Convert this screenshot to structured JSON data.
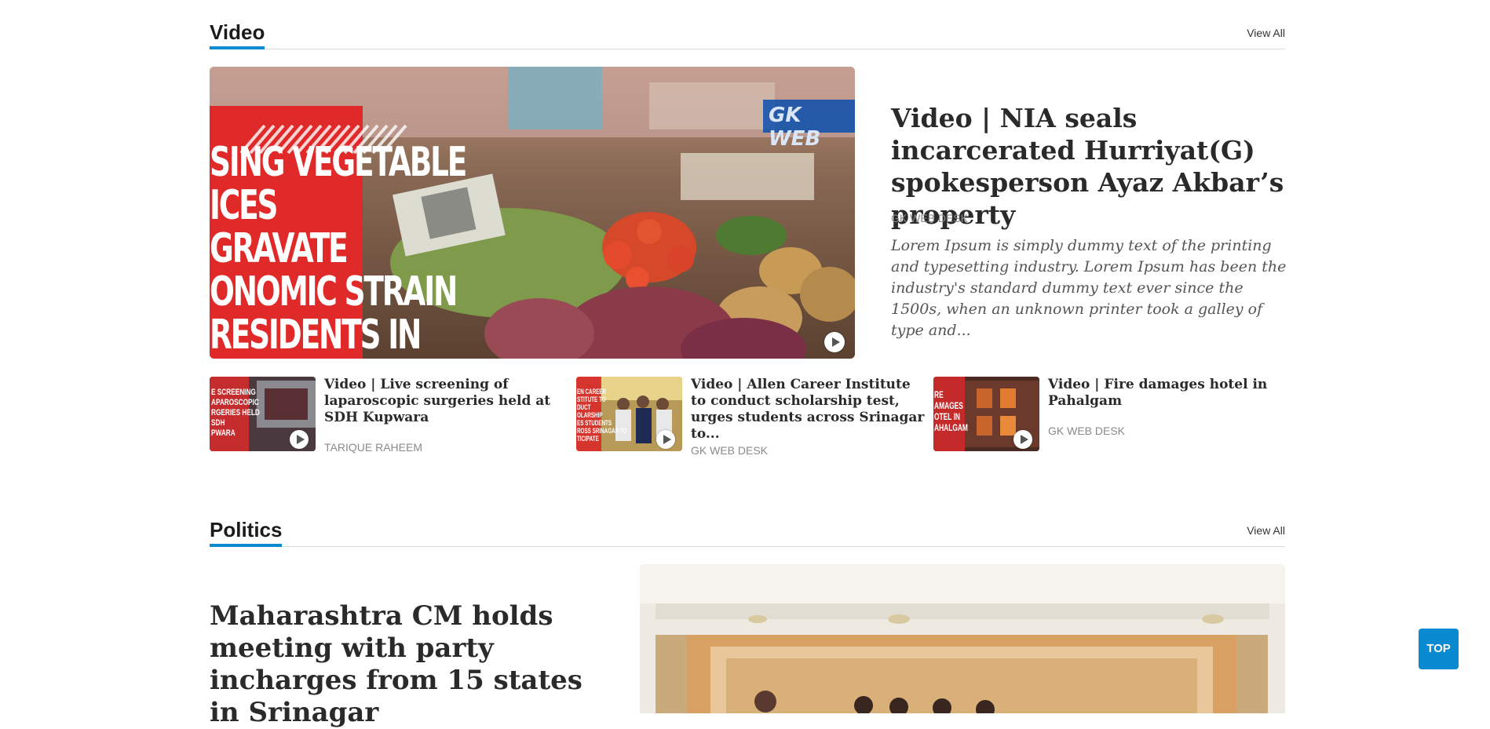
{
  "video_section": {
    "title": "Video",
    "view_all": "View All",
    "hero": {
      "overlay_lines": [
        "SING VEGETABLE",
        "ICES",
        "GRAVATE",
        "ONOMIC STRAIN",
        "RESIDENTS IN"
      ],
      "logo_text": "GK WEB",
      "title": "Video | NIA seals incarcerated Hurriyat(G) spokesperson Ayaz Akbar’s property",
      "author": "GK WEB DESK",
      "description": "Lorem Ipsum is simply dummy text of the printing and typesetting industry. Lorem Ipsum has been the industry's standard dummy text ever since the 1500s, when an unknown printer took a galley of type and..."
    },
    "items": [
      {
        "title": "Video | Live screening of laparoscopic surgeries held at SDH Kupwara",
        "author": "TARIQUE RAHEEM",
        "thumb_text": "E SCREENING\nAPAROSCOPIC\nRGERIES HELD\nSDH\nPWARA"
      },
      {
        "title": "Video | Allen Career Institute to conduct scholarship test, urges students across Srinagar to...",
        "author": "GK WEB DESK",
        "thumb_text": "EN CAREER\nSTITUTE TO\nDUCT\nOLARSHIP\nES STUDENTS\nROSS SRINAGAR TO\nTICIPATE"
      },
      {
        "title": "Video | Fire damages hotel in Pahalgam",
        "author": "GK WEB DESK",
        "thumb_text": "RE\nAMAGES\nOTEL IN\nAHALGAM"
      }
    ]
  },
  "politics_section": {
    "title": "Politics",
    "view_all": "View All",
    "lead_title": "Maharashtra CM holds meeting with party incharges from 15 states in Srinagar"
  },
  "top_button": "TOP",
  "colors": {
    "accent": "#0a8ad0",
    "overlay_red": "#e02a2a"
  }
}
